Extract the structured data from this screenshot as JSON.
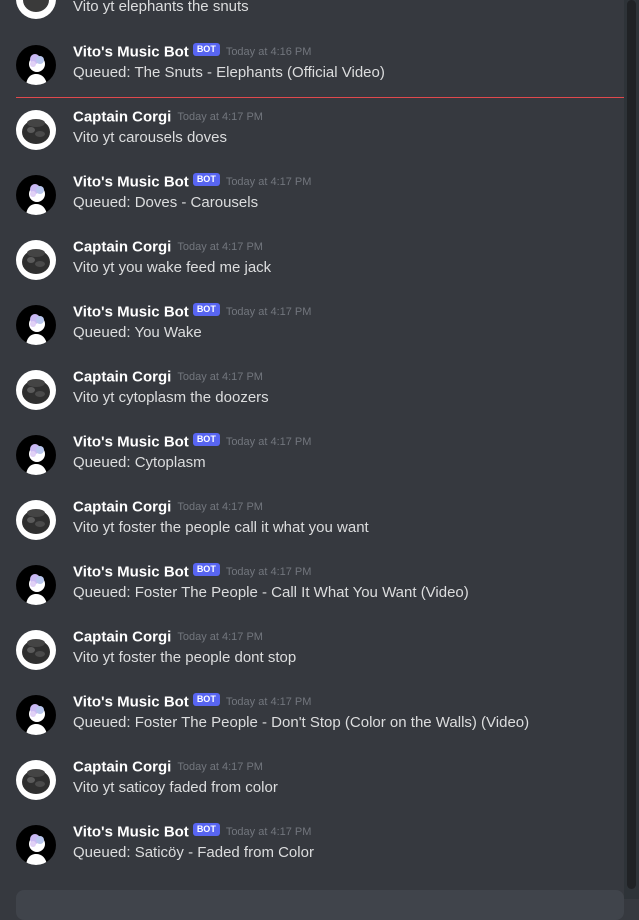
{
  "partial_message": {
    "text": "Vito yt elephants the snuts"
  },
  "messages": [
    {
      "author": "Vito's Music Bot",
      "bot": true,
      "badge": "BOT",
      "time": "Today at 4:16 PM",
      "text": "Queued: The Snuts - Elephants (Official Video)"
    },
    {
      "author": "Captain Corgi",
      "bot": false,
      "time": "Today at 4:17 PM",
      "text": "Vito yt carousels doves"
    },
    {
      "author": "Vito's Music Bot",
      "bot": true,
      "badge": "BOT",
      "time": "Today at 4:17 PM",
      "text": "Queued: Doves - Carousels"
    },
    {
      "author": "Captain Corgi",
      "bot": false,
      "time": "Today at 4:17 PM",
      "text": "Vito yt you wake feed me jack"
    },
    {
      "author": "Vito's Music Bot",
      "bot": true,
      "badge": "BOT",
      "time": "Today at 4:17 PM",
      "text": "Queued: You Wake"
    },
    {
      "author": "Captain Corgi",
      "bot": false,
      "time": "Today at 4:17 PM",
      "text": "Vito yt cytoplasm the doozers"
    },
    {
      "author": "Vito's Music Bot",
      "bot": true,
      "badge": "BOT",
      "time": "Today at 4:17 PM",
      "text": "Queued: Cytoplasm"
    },
    {
      "author": "Captain Corgi",
      "bot": false,
      "time": "Today at 4:17 PM",
      "text": "Vito yt foster the people call it what you want"
    },
    {
      "author": "Vito's Music Bot",
      "bot": true,
      "badge": "BOT",
      "time": "Today at 4:17 PM",
      "text": "Queued: Foster The People - Call It What You Want (Video)"
    },
    {
      "author": "Captain Corgi",
      "bot": false,
      "time": "Today at 4:17 PM",
      "text": "Vito yt foster the people dont stop"
    },
    {
      "author": "Vito's Music Bot",
      "bot": true,
      "badge": "BOT",
      "time": "Today at 4:17 PM",
      "text": "Queued: Foster The People - Don't Stop (Color on the Walls) (Video)"
    },
    {
      "author": "Captain Corgi",
      "bot": false,
      "time": "Today at 4:17 PM",
      "text": "Vito yt saticoy faded from color"
    },
    {
      "author": "Vito's Music Bot",
      "bot": true,
      "badge": "BOT",
      "time": "Today at 4:17 PM",
      "text": "Queued: Saticöy - Faded from Color"
    }
  ],
  "colors": {
    "background": "#36393f",
    "bot_badge": "#5865f2",
    "new_divider": "#e0494d",
    "username": "#ffffff",
    "timestamp": "#72767d"
  }
}
